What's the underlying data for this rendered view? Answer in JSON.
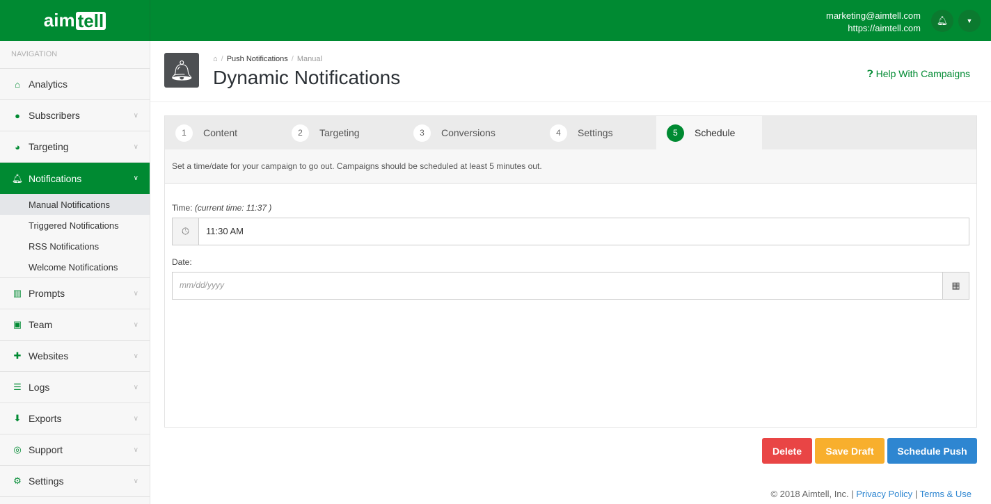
{
  "header": {
    "logo_a": "aim",
    "logo_b": "tell",
    "email": "marketing@aimtell.com",
    "site": "https://aimtell.com"
  },
  "sidebar": {
    "heading": "NAVIGATION",
    "items": [
      {
        "label": "Analytics",
        "icon": "home-icon"
      },
      {
        "label": "Subscribers",
        "icon": "users-icon"
      },
      {
        "label": "Targeting",
        "icon": "pie-chart-icon"
      },
      {
        "label": "Notifications",
        "icon": "bell-icon"
      },
      {
        "label": "Prompts",
        "icon": "map-icon"
      },
      {
        "label": "Team",
        "icon": "badge-icon"
      },
      {
        "label": "Websites",
        "icon": "puzzle-icon"
      },
      {
        "label": "Logs",
        "icon": "list-icon"
      },
      {
        "label": "Exports",
        "icon": "download-icon"
      },
      {
        "label": "Support",
        "icon": "life-ring-icon"
      },
      {
        "label": "Settings",
        "icon": "gears-icon"
      }
    ],
    "subitems": [
      "Manual Notifications",
      "Triggered Notifications",
      "RSS Notifications",
      "Welcome Notifications"
    ]
  },
  "page": {
    "breadcrumb": [
      "Push Notifications",
      "Manual"
    ],
    "title": "Dynamic Notifications",
    "help": "Help With Campaigns"
  },
  "tabs": [
    {
      "n": "1",
      "label": "Content"
    },
    {
      "n": "2",
      "label": "Targeting"
    },
    {
      "n": "3",
      "label": "Conversions"
    },
    {
      "n": "4",
      "label": "Settings"
    },
    {
      "n": "5",
      "label": "Schedule"
    }
  ],
  "schedule": {
    "info": "Set a time/date for your campaign to go out. Campaigns should be scheduled at least 5 minutes out.",
    "time_label": "Time:",
    "current_time": "(current time: 11:37 )",
    "time_value": "11:30 AM",
    "date_label": "Date:",
    "date_placeholder": "mm/dd/yyyy"
  },
  "buttons": {
    "delete": "Delete",
    "save": "Save Draft",
    "schedule": "Schedule Push"
  },
  "colors": {
    "brand": "#008a32",
    "delete": "#e94545",
    "save": "#f8af2d",
    "schedule": "#2e86d1"
  },
  "footer": {
    "copy": "© 2018 Aimtell, Inc. |",
    "privacy": "Privacy Policy",
    "sep": "|",
    "terms": "Terms & Use"
  }
}
